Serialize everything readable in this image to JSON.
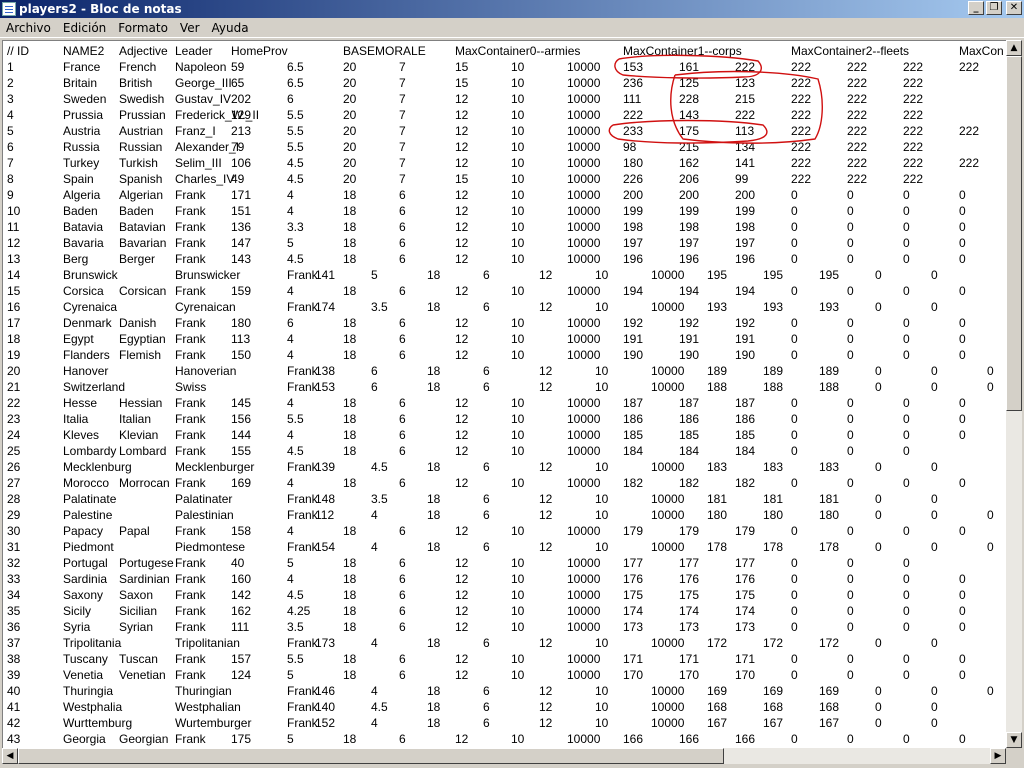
{
  "window": {
    "title": "players2 - Bloc de notas",
    "buttons": [
      "_",
      "❐",
      "✕"
    ]
  },
  "menu": [
    "Archivo",
    "Edición",
    "Formato",
    "Ver",
    "Ayuda"
  ],
  "header": [
    "// ID",
    "NAME2",
    "Adjective",
    "Leader",
    "HomeProv",
    "BASEMORALE",
    "MaxContainer0--armies",
    "MaxContainer1--corps",
    "MaxContainer2--fleets",
    "MaxCon"
  ],
  "rows": [
    [
      "1",
      "France",
      "French",
      "Napoleon",
      "59",
      "6.5",
      "20",
      "7",
      "15",
      "10",
      "10000",
      "153",
      "161",
      "222",
      "222",
      "222",
      "222",
      "222"
    ],
    [
      "2",
      "Britain",
      "British",
      "George_III",
      "65",
      "6.5",
      "20",
      "7",
      "15",
      "10",
      "10000",
      "236",
      "125",
      "123",
      "222",
      "222",
      "222"
    ],
    [
      "3",
      "Sweden",
      "Swedish",
      "Gustav_IV",
      "202",
      "6",
      "20",
      "7",
      "12",
      "10",
      "10000",
      "111",
      "228",
      "215",
      "222",
      "222",
      "222"
    ],
    [
      "4",
      "Prussia",
      "Prussian",
      "Frederick_W._II",
      "129",
      "5.5",
      "20",
      "7",
      "12",
      "10",
      "10000",
      "222",
      "143",
      "222",
      "222",
      "222",
      "222"
    ],
    [
      "5",
      "Austria",
      "Austrian",
      "Franz_I",
      "213",
      "5.5",
      "20",
      "7",
      "12",
      "10",
      "10000",
      "233",
      "175",
      "113",
      "222",
      "222",
      "222",
      "222"
    ],
    [
      "6",
      "Russia",
      "Russian",
      "Alexander_I",
      "79",
      "5.5",
      "20",
      "7",
      "12",
      "10",
      "10000",
      "98",
      "215",
      "134",
      "222",
      "222",
      "222"
    ],
    [
      "7",
      "Turkey",
      "Turkish",
      "Selim_III",
      "106",
      "4.5",
      "20",
      "7",
      "12",
      "10",
      "10000",
      "180",
      "162",
      "141",
      "222",
      "222",
      "222",
      "222"
    ],
    [
      "8",
      "Spain",
      "Spanish",
      "Charles_IV",
      "49",
      "4.5",
      "20",
      "7",
      "15",
      "10",
      "10000",
      "226",
      "206",
      "99",
      "222",
      "222",
      "222"
    ],
    [
      "9",
      "Algeria",
      "Algerian",
      "Frank",
      "171",
      "4",
      "18",
      "6",
      "12",
      "10",
      "10000",
      "200",
      "200",
      "200",
      "0",
      "0",
      "0",
      "0"
    ],
    [
      "10",
      "Baden",
      "Baden",
      "Frank",
      "151",
      "4",
      "18",
      "6",
      "12",
      "10",
      "10000",
      "199",
      "199",
      "199",
      "0",
      "0",
      "0",
      "0"
    ],
    [
      "11",
      "Batavia",
      "Batavian",
      "Frank",
      "136",
      "3.3",
      "18",
      "6",
      "12",
      "10",
      "10000",
      "198",
      "198",
      "198",
      "0",
      "0",
      "0",
      "0"
    ],
    [
      "12",
      "Bavaria",
      "Bavarian",
      "Frank",
      "147",
      "5",
      "18",
      "6",
      "12",
      "10",
      "10000",
      "197",
      "197",
      "197",
      "0",
      "0",
      "0",
      "0"
    ],
    [
      "13",
      "Berg",
      "Berger",
      "Frank",
      "143",
      "4.5",
      "18",
      "6",
      "12",
      "10",
      "10000",
      "196",
      "196",
      "196",
      "0",
      "0",
      "0",
      "0"
    ],
    [
      "14",
      "Brunswick",
      "Brunswicker",
      "Frank",
      "141",
      "5",
      "18",
      "6",
      "12",
      "10",
      "10000",
      "195",
      "195",
      "195",
      "0",
      "0"
    ],
    [
      "15",
      "Corsica",
      "Corsican",
      "Frank",
      "159",
      "4",
      "18",
      "6",
      "12",
      "10",
      "10000",
      "194",
      "194",
      "194",
      "0",
      "0",
      "0",
      "0"
    ],
    [
      "16",
      "Cyrenaica",
      "Cyrenaican",
      "Frank",
      "174",
      "3.5",
      "18",
      "6",
      "12",
      "10",
      "10000",
      "193",
      "193",
      "193",
      "0",
      "0"
    ],
    [
      "17",
      "Denmark",
      "Danish",
      "Frank",
      "180",
      "6",
      "18",
      "6",
      "12",
      "10",
      "10000",
      "192",
      "192",
      "192",
      "0",
      "0",
      "0",
      "0"
    ],
    [
      "18",
      "Egypt",
      "Egyptian",
      "Frank",
      "113",
      "4",
      "18",
      "6",
      "12",
      "10",
      "10000",
      "191",
      "191",
      "191",
      "0",
      "0",
      "0",
      "0"
    ],
    [
      "19",
      "Flanders",
      "Flemish",
      "Frank",
      "150",
      "4",
      "18",
      "6",
      "12",
      "10",
      "10000",
      "190",
      "190",
      "190",
      "0",
      "0",
      "0",
      "0"
    ],
    [
      "20",
      "Hanover",
      "Hanoverian",
      "Frank",
      "138",
      "6",
      "18",
      "6",
      "12",
      "10",
      "10000",
      "189",
      "189",
      "189",
      "0",
      "0",
      "0"
    ],
    [
      "21",
      "Switzerland",
      "Swiss",
      "Frank",
      "153",
      "6",
      "18",
      "6",
      "12",
      "10",
      "10000",
      "188",
      "188",
      "188",
      "0",
      "0",
      "0"
    ],
    [
      "22",
      "Hesse",
      "Hessian",
      "Frank",
      "145",
      "4",
      "18",
      "6",
      "12",
      "10",
      "10000",
      "187",
      "187",
      "187",
      "0",
      "0",
      "0",
      "0"
    ],
    [
      "23",
      "Italia",
      "Italian",
      "Frank",
      "156",
      "5.5",
      "18",
      "6",
      "12",
      "10",
      "10000",
      "186",
      "186",
      "186",
      "0",
      "0",
      "0",
      "0"
    ],
    [
      "24",
      "Kleves",
      "Klevian",
      "Frank",
      "144",
      "4",
      "18",
      "6",
      "12",
      "10",
      "10000",
      "185",
      "185",
      "185",
      "0",
      "0",
      "0",
      "0"
    ],
    [
      "25",
      "Lombardy",
      "Lombard",
      "Frank",
      "155",
      "4.5",
      "18",
      "6",
      "12",
      "10",
      "10000",
      "184",
      "184",
      "184",
      "0",
      "0",
      "0"
    ],
    [
      "26",
      "Mecklenburg",
      "Mecklenburger",
      "Frank",
      "139",
      "4.5",
      "18",
      "6",
      "12",
      "10",
      "10000",
      "183",
      "183",
      "183",
      "0",
      "0"
    ],
    [
      "27",
      "Morocco",
      "Morrocan",
      "Frank",
      "169",
      "4",
      "18",
      "6",
      "12",
      "10",
      "10000",
      "182",
      "182",
      "182",
      "0",
      "0",
      "0",
      "0"
    ],
    [
      "28",
      "Palatinate",
      "Palatinater",
      "Frank",
      "148",
      "3.5",
      "18",
      "6",
      "12",
      "10",
      "10000",
      "181",
      "181",
      "181",
      "0",
      "0"
    ],
    [
      "29",
      "Palestine",
      "Palestinian",
      "Frank",
      "112",
      "4",
      "18",
      "6",
      "12",
      "10",
      "10000",
      "180",
      "180",
      "180",
      "0",
      "0",
      "0"
    ],
    [
      "30",
      "Papacy",
      "Papal",
      "Frank",
      "158",
      "4",
      "18",
      "6",
      "12",
      "10",
      "10000",
      "179",
      "179",
      "179",
      "0",
      "0",
      "0",
      "0"
    ],
    [
      "31",
      "Piedmont",
      "Piedmontese",
      "Frank",
      "154",
      "4",
      "18",
      "6",
      "12",
      "10",
      "10000",
      "178",
      "178",
      "178",
      "0",
      "0",
      "0"
    ],
    [
      "32",
      "Portugal",
      "Portugese",
      "Frank",
      "40",
      "5",
      "18",
      "6",
      "12",
      "10",
      "10000",
      "177",
      "177",
      "177",
      "0",
      "0",
      "0"
    ],
    [
      "33",
      "Sardinia",
      "Sardinian",
      "Frank",
      "160",
      "4",
      "18",
      "6",
      "12",
      "10",
      "10000",
      "176",
      "176",
      "176",
      "0",
      "0",
      "0",
      "0"
    ],
    [
      "34",
      "Saxony",
      "Saxon",
      "Frank",
      "142",
      "4.5",
      "18",
      "6",
      "12",
      "10",
      "10000",
      "175",
      "175",
      "175",
      "0",
      "0",
      "0",
      "0"
    ],
    [
      "35",
      "Sicily",
      "Sicilian",
      "Frank",
      "162",
      "4.25",
      "18",
      "6",
      "12",
      "10",
      "10000",
      "174",
      "174",
      "174",
      "0",
      "0",
      "0",
      "0"
    ],
    [
      "36",
      "Syria",
      "Syrian",
      "Frank",
      "111",
      "3.5",
      "18",
      "6",
      "12",
      "10",
      "10000",
      "173",
      "173",
      "173",
      "0",
      "0",
      "0",
      "0"
    ],
    [
      "37",
      "Tripolitania",
      "Tripolitanian",
      "Frank",
      "173",
      "4",
      "18",
      "6",
      "12",
      "10",
      "10000",
      "172",
      "172",
      "172",
      "0",
      "0"
    ],
    [
      "38",
      "Tuscany",
      "Tuscan",
      "Frank",
      "157",
      "5.5",
      "18",
      "6",
      "12",
      "10",
      "10000",
      "171",
      "171",
      "171",
      "0",
      "0",
      "0",
      "0"
    ],
    [
      "39",
      "Venetia",
      "Venetian",
      "Frank",
      "124",
      "5",
      "18",
      "6",
      "12",
      "10",
      "10000",
      "170",
      "170",
      "170",
      "0",
      "0",
      "0",
      "0"
    ],
    [
      "40",
      "Thuringia",
      "Thuringian",
      "Frank",
      "146",
      "4",
      "18",
      "6",
      "12",
      "10",
      "10000",
      "169",
      "169",
      "169",
      "0",
      "0",
      "0"
    ],
    [
      "41",
      "Westphalia",
      "Westphalian",
      "Frank",
      "140",
      "4.5",
      "18",
      "6",
      "12",
      "10",
      "10000",
      "168",
      "168",
      "168",
      "0",
      "0"
    ],
    [
      "42",
      "Wurttemburg",
      "Wurtemburger",
      "Frank",
      "152",
      "4",
      "18",
      "6",
      "12",
      "10",
      "10000",
      "167",
      "167",
      "167",
      "0",
      "0"
    ],
    [
      "43",
      "Georgia",
      "Georgian",
      "Frank",
      "175",
      "5",
      "18",
      "6",
      "12",
      "10",
      "10000",
      "166",
      "166",
      "166",
      "0",
      "0",
      "0",
      "0"
    ]
  ],
  "annotation_color": "#d01010"
}
